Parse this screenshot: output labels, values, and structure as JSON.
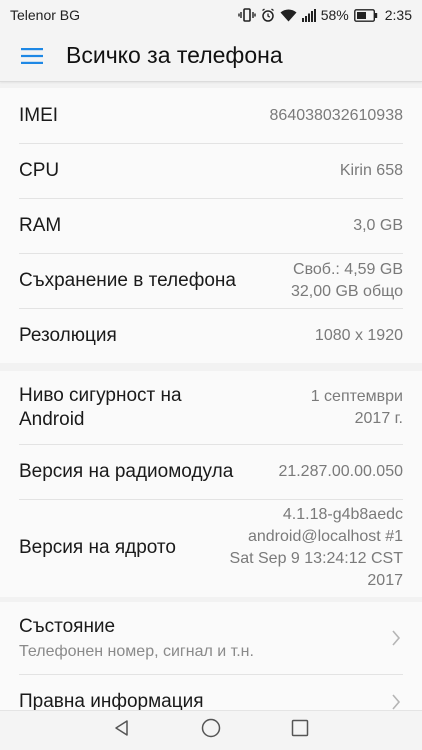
{
  "status_bar": {
    "carrier": "Telenor BG",
    "battery_percent": "58%",
    "time": "2:35"
  },
  "app_bar": {
    "title": "Всичко за телефона"
  },
  "info_rows": [
    {
      "label": "IMEI",
      "value": "864038032610938"
    },
    {
      "label": "CPU",
      "value": "Kirin 658"
    },
    {
      "label": "RAM",
      "value": "3,0 GB"
    },
    {
      "label": "Съхранение в телефона",
      "value_line1": "Своб.: 4,59  GB",
      "value_line2": "32,00  GB общо"
    },
    {
      "label": "Резолюция",
      "value": "1080 x 1920"
    }
  ],
  "version_rows": [
    {
      "label_line1": "Ниво сигурност на",
      "label_line2": "Android",
      "value_line1": "1 септември",
      "value_line2": "2017 г."
    },
    {
      "label": "Версия на радиомодула",
      "value": "21.287.00.00.050"
    },
    {
      "label": "Версия на ядрото",
      "value_lines": [
        "4.1.18-g4b8aedc",
        "android@localhost #1",
        "Sat Sep 9 13:24:12 CST",
        "2017"
      ]
    }
  ],
  "nav_rows": [
    {
      "label": "Състояние",
      "sublabel": "Телефонен номер, сигнал и т.н."
    },
    {
      "label": "Правна информация"
    }
  ]
}
